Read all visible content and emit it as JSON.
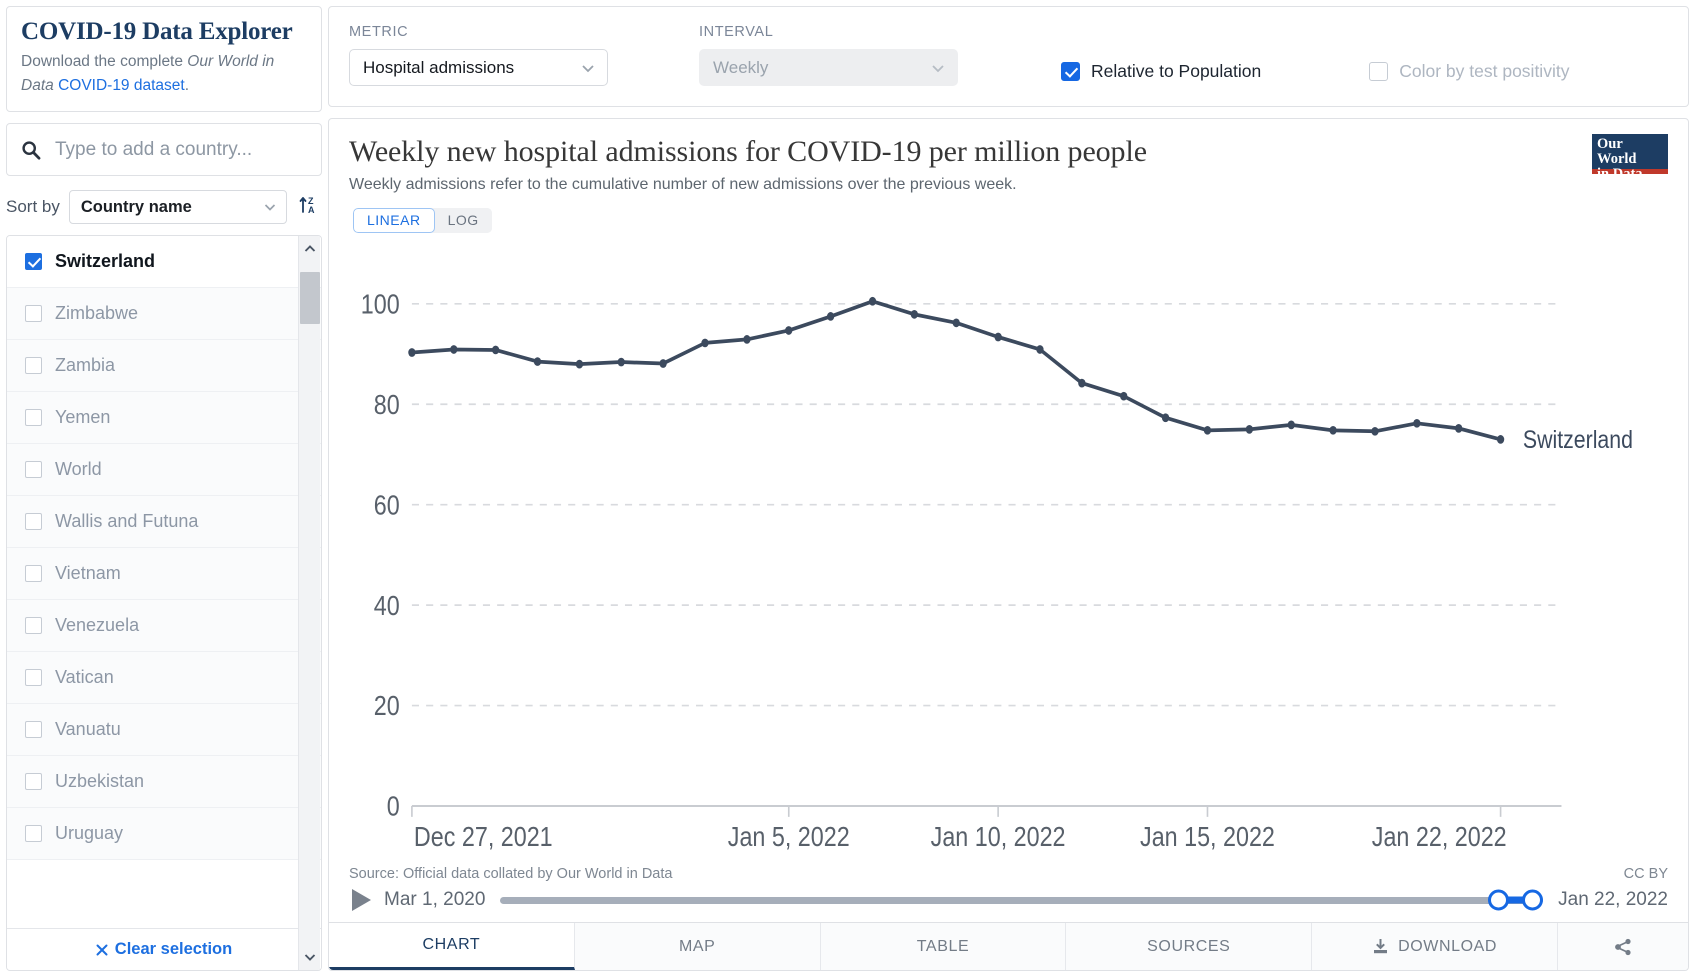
{
  "brand": {
    "title": "COVID-19 Data Explorer",
    "sub_prefix": "Download the complete ",
    "sub_italic": "Our World in Data",
    "sub_link": "COVID-19 dataset",
    "sub_suffix": "."
  },
  "search": {
    "placeholder": "Type to add a country...",
    "value": "",
    "icon": "search-icon"
  },
  "sort": {
    "label": "Sort by",
    "value": "Country name",
    "direction_icon": "sort-az-icon"
  },
  "countries": [
    {
      "name": "Switzerland",
      "checked": true
    },
    {
      "name": "Zimbabwe",
      "checked": false
    },
    {
      "name": "Zambia",
      "checked": false
    },
    {
      "name": "Yemen",
      "checked": false
    },
    {
      "name": "World",
      "checked": false
    },
    {
      "name": "Wallis and Futuna",
      "checked": false
    },
    {
      "name": "Vietnam",
      "checked": false
    },
    {
      "name": "Venezuela",
      "checked": false
    },
    {
      "name": "Vatican",
      "checked": false
    },
    {
      "name": "Vanuatu",
      "checked": false
    },
    {
      "name": "Uzbekistan",
      "checked": false
    },
    {
      "name": "Uruguay",
      "checked": false
    }
  ],
  "clear_selection": "Clear selection",
  "controls": {
    "metric_label": "METRIC",
    "metric_value": "Hospital admissions",
    "interval_label": "INTERVAL",
    "interval_value": "Weekly",
    "relative_label": "Relative to Population",
    "relative_checked": true,
    "positivity_label": "Color by test positivity",
    "positivity_checked": false
  },
  "chart": {
    "title": "Weekly new hospital admissions for COVID-19 per million people",
    "subtitle": "Weekly admissions refer to the cumulative number of new admissions over the previous week.",
    "logo_line1": "Our World",
    "logo_line2": "in Data",
    "scale_linear": "LINEAR",
    "scale_log": "LOG",
    "scale_selected": "LINEAR",
    "source": "Source: Official data collated by Our World in Data",
    "license": "CC BY",
    "series_label": "Switzerland",
    "line_color": "#3c4a5e"
  },
  "chart_data": {
    "type": "line",
    "title": "Weekly new hospital admissions for COVID-19 per million people",
    "subtitle": "Weekly admissions refer to the cumulative number of new admissions over the previous week.",
    "xlabel": "",
    "ylabel": "",
    "ylim": [
      0,
      108
    ],
    "yticks": [
      0,
      20,
      40,
      60,
      80,
      100
    ],
    "xticks": [
      "Dec 27, 2021",
      "Jan 5, 2022",
      "Jan 10, 2022",
      "Jan 15, 2022",
      "Jan 22, 2022"
    ],
    "xtick_positions": [
      0,
      9,
      14,
      19,
      26
    ],
    "xrange": [
      "Dec 27, 2021",
      "Jan 22, 2022"
    ],
    "grid": "horizontal-dashed",
    "legend": "right-series-label",
    "series": [
      {
        "name": "Switzerland",
        "color": "#3c4a5e",
        "x": [
          "Dec 27, 2021",
          "Dec 28, 2021",
          "Dec 29, 2021",
          "Dec 30, 2021",
          "Dec 31, 2021",
          "Jan 1, 2022",
          "Jan 2, 2022",
          "Jan 3, 2022",
          "Jan 4, 2022",
          "Jan 5, 2022",
          "Jan 6, 2022",
          "Jan 7, 2022",
          "Jan 8, 2022",
          "Jan 9, 2022",
          "Jan 10, 2022",
          "Jan 11, 2022",
          "Jan 12, 2022",
          "Jan 13, 2022",
          "Jan 14, 2022",
          "Jan 15, 2022",
          "Jan 16, 2022",
          "Jan 17, 2022",
          "Jan 18, 2022",
          "Jan 19, 2022",
          "Jan 20, 2022",
          "Jan 21, 2022",
          "Jan 22, 2022"
        ],
        "y": [
          90.3,
          90.9,
          90.8,
          88.5,
          88.0,
          88.4,
          88.1,
          92.2,
          92.9,
          94.7,
          97.5,
          100.5,
          97.9,
          96.2,
          93.4,
          90.9,
          84.2,
          81.6,
          77.3,
          74.8,
          75.0,
          75.9,
          74.8,
          74.6,
          76.2,
          75.2,
          73.0
        ]
      }
    ]
  },
  "timeline": {
    "play_icon": "play-icon",
    "start": "Mar 1, 2020",
    "end": "Jan 22, 2022"
  },
  "tabs": [
    {
      "label": "CHART",
      "active": true,
      "icon": null
    },
    {
      "label": "MAP",
      "active": false,
      "icon": null
    },
    {
      "label": "TABLE",
      "active": false,
      "icon": null
    },
    {
      "label": "SOURCES",
      "active": false,
      "icon": null
    },
    {
      "label": "DOWNLOAD",
      "active": false,
      "icon": "download-icon"
    },
    {
      "label": "",
      "active": false,
      "icon": "share-icon"
    }
  ]
}
